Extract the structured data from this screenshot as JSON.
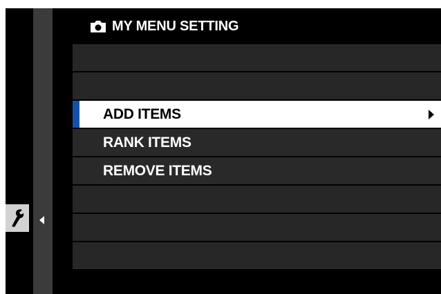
{
  "header": {
    "title": "MY MENU SETTING",
    "icon": "camera-icon"
  },
  "sidebar": {
    "active_tab_icon": "wrench-icon",
    "collapse_icon": "chevron-left-icon"
  },
  "menu": {
    "items": [
      {
        "label": "",
        "state": "empty"
      },
      {
        "label": "",
        "state": "empty"
      },
      {
        "label": "ADD ITEMS",
        "state": "selected",
        "has_submenu": true
      },
      {
        "label": "RANK ITEMS",
        "state": "normal"
      },
      {
        "label": "REMOVE ITEMS",
        "state": "normal"
      },
      {
        "label": "",
        "state": "empty"
      },
      {
        "label": "",
        "state": "empty"
      },
      {
        "label": "",
        "state": "empty"
      }
    ]
  },
  "colors": {
    "background": "#000000",
    "row": "#292929",
    "selected_row": "#ffffff",
    "selection_accent": "#1450a8",
    "tab_strip": "#3b3b3b",
    "tab_icon_bg": "#d2d2d2"
  }
}
